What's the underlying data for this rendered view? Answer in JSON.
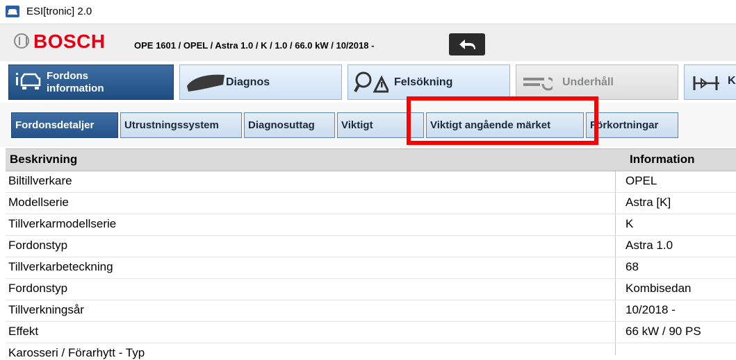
{
  "window": {
    "title": "ESI[tronic] 2.0"
  },
  "header": {
    "brand": "BOSCH",
    "vehicle": "OPE 1601 / OPEL / Astra 1.0 / K / 1.0 / 66.0 kW / 10/2018 -"
  },
  "main_tabs": [
    {
      "label": "Fordons information",
      "icon": "car-info-icon",
      "state": "active"
    },
    {
      "label": "Diagnos",
      "icon": "diagnostic-plug-icon",
      "state": "normal"
    },
    {
      "label": "Felsökning",
      "icon": "troubleshooting-icon",
      "state": "normal"
    },
    {
      "label": "Underhåll",
      "icon": "maintenance-icon",
      "state": "disabled"
    },
    {
      "label": "K",
      "icon": "component-icon",
      "state": "normal"
    }
  ],
  "sub_tabs": [
    {
      "label": "Fordonsdetaljer",
      "state": "active"
    },
    {
      "label": "Utrustningssystem"
    },
    {
      "label": "Diagnosuttag"
    },
    {
      "label": "Viktigt"
    },
    {
      "label": "Viktigt angående märket"
    },
    {
      "label": "Förkortningar"
    }
  ],
  "table": {
    "headers": {
      "desc": "Beskrivning",
      "info": "Information"
    },
    "rows": [
      {
        "desc": "Biltillverkare",
        "info": "OPEL"
      },
      {
        "desc": "Modellserie",
        "info": "Astra [K]"
      },
      {
        "desc": "Tillverkarmodellserie",
        "info": "K"
      },
      {
        "desc": "Fordonstyp",
        "info": "Astra 1.0"
      },
      {
        "desc": "Tillverkarbeteckning",
        "info": "68"
      },
      {
        "desc": "Fordonstyp",
        "info": "Kombisedan"
      },
      {
        "desc": "Tillverkningsår",
        "info": "10/2018  -"
      },
      {
        "desc": "Effekt",
        "info": "66 kW / 90 PS"
      },
      {
        "desc": "Karosseri / Förarhytt - Typ",
        "info": ""
      }
    ]
  },
  "colors": {
    "brand": "#e20015",
    "highlight": "#ff0000",
    "active_tab": "#2b5a8f"
  }
}
